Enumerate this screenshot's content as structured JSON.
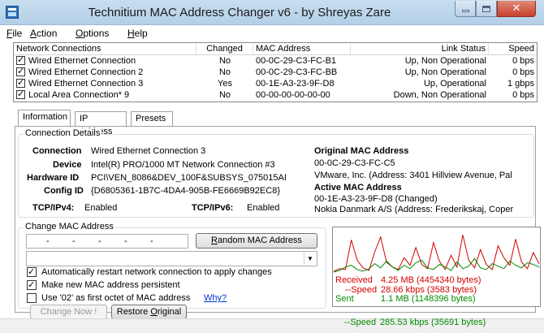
{
  "window": {
    "title": "Technitium MAC Address Changer v6 - by Shreyas Zare",
    "close_glyph": "✕"
  },
  "menu": [
    {
      "label": "File",
      "accel": "F",
      "rest": "ile"
    },
    {
      "label": "Action",
      "accel": "A",
      "rest": "ction"
    },
    {
      "label": "Options",
      "accel": "O",
      "rest": "ptions"
    },
    {
      "label": "Help",
      "accel": "H",
      "rest": "elp"
    }
  ],
  "connections": {
    "headers": [
      "Network Connections",
      "Changed",
      "MAC Address",
      "Link Status",
      "Speed"
    ],
    "rows": [
      {
        "name": "Wired Ethernet Connection",
        "checked": true,
        "changed": "No",
        "mac": "00-0C-29-C3-FC-B1",
        "status": "Up, Non Operational",
        "speed": "0 bps"
      },
      {
        "name": "Wired Ethernet Connection 2",
        "checked": true,
        "changed": "No",
        "mac": "00-0C-29-C3-FC-BB",
        "status": "Up, Non Operational",
        "speed": "0 bps"
      },
      {
        "name": "Wired Ethernet Connection 3",
        "checked": true,
        "changed": "Yes",
        "mac": "00-1E-A3-23-9F-D8",
        "status": "Up, Operational",
        "speed": "1 gbps"
      },
      {
        "name": "Local Area Connection* 9",
        "checked": true,
        "changed": "No",
        "mac": "00-00-00-00-00-00",
        "status": "Down, Non Operational",
        "speed": "0 bps"
      }
    ]
  },
  "tabs": [
    {
      "label": "Information",
      "active": true
    },
    {
      "label": "IP Address",
      "active": false
    },
    {
      "label": "Presets",
      "active": false
    }
  ],
  "details": {
    "group_title": "Connection Details",
    "connection_label": "Connection",
    "connection_value": "Wired Ethernet Connection 3",
    "device_label": "Device",
    "device_value": "Intel(R) PRO/1000 MT Network Connection #3",
    "hardware_label": "Hardware ID",
    "hardware_value": "PCI\\VEN_8086&DEV_100F&SUBSYS_075015AI",
    "config_label": "Config ID",
    "config_value": "{D6805361-1B7C-4DA4-905B-FE6669B92EC8}",
    "tcp4_label": "TCP/IPv4:",
    "tcp4_value": "Enabled",
    "tcp6_label": "TCP/IPv6:",
    "tcp6_value": "Enabled",
    "orig_mac_title": "Original MAC Address",
    "orig_mac": "00-0C-29-C3-FC-C5",
    "orig_vendor": "VMware, Inc.  (Address: 3401 Hillview Avenue, Pal",
    "active_mac_title": "Active MAC Address",
    "active_mac": "00-1E-A3-23-9F-D8 (Changed)",
    "active_vendor": "Nokia Danmark A/S  (Address: Frederikskaj, Coper"
  },
  "change": {
    "group_title": "Change MAC Address",
    "mac_placeholder": "-",
    "random_accel": "R",
    "random_rest": "andom MAC Address",
    "combo_value": "",
    "combo_arrow": "▼",
    "opt_restart": "Automatically restart network connection to apply changes",
    "opt_restart_checked": true,
    "opt_persist": "Make new MAC address persistent",
    "opt_persist_checked": true,
    "opt_02": "Use '02' as first octet of MAC address",
    "opt_02_checked": false,
    "why_link": "Why?",
    "change_now": "Change Now !",
    "restore_pre": "Restore ",
    "restore_accel": "O",
    "restore_rest": "riginal",
    "check_glyph": "✓"
  },
  "traffic": {
    "received_label": "Received",
    "received_value": "4.25 MB (4454340 bytes)",
    "rx_speed_label": "--Speed",
    "rx_speed_value": "28.66 kbps (3583 bytes)",
    "sent_label": "Sent",
    "sent_value": "1.1 MB (1148396 bytes)",
    "tx_speed_label": "--Speed",
    "tx_speed_value": "285.53 kbps (35691 bytes)",
    "colors": {
      "received": "#d40000",
      "sent": "#008a00"
    },
    "received_series": [
      4,
      10,
      8,
      78,
      30,
      12,
      6,
      50,
      85,
      25,
      14,
      8,
      36,
      18,
      60,
      20,
      10,
      72,
      28,
      8,
      42,
      14,
      90,
      30,
      12,
      55,
      20,
      8,
      64,
      36,
      18,
      80,
      26,
      10,
      48,
      22
    ],
    "sent_series": [
      2,
      6,
      14,
      18,
      8,
      4,
      10,
      22,
      12,
      28,
      14,
      6,
      18,
      10,
      24,
      30,
      12,
      8,
      20,
      14,
      6,
      26,
      10,
      16,
      34,
      12,
      8,
      22,
      16,
      10,
      28,
      18,
      12,
      24,
      20,
      14
    ]
  }
}
